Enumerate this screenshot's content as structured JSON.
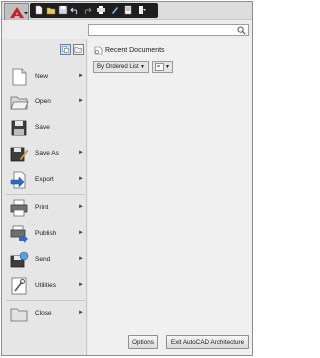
{
  "app_menu": {
    "logo_icon": "autocad-a-logo-icon",
    "quick_access_icons": [
      "new-icon",
      "open-icon",
      "save-icon",
      "undo-icon",
      "redo-icon",
      "plot-icon",
      "pen-icon",
      "layer-icon",
      "dropdown-icon"
    ]
  },
  "search": {
    "value": "",
    "icon": "magnifier-icon"
  },
  "view_toggles": [
    "large-icons-view-icon",
    "small-icons-view-icon"
  ],
  "left_menu": {
    "items": [
      {
        "label": "New",
        "icon": "new-drawing-icon",
        "has_arrow": true
      },
      {
        "label": "Open",
        "icon": "open-folder-icon",
        "has_arrow": true
      },
      {
        "label": "Save",
        "icon": "floppy-save-icon",
        "has_arrow": false
      },
      {
        "label": "Save As",
        "icon": "save-as-icon",
        "has_arrow": true
      },
      {
        "label": "Export",
        "icon": "export-icon",
        "has_arrow": true
      },
      {
        "label": "Print",
        "icon": "printer-icon",
        "has_arrow": true
      },
      {
        "label": "Publish",
        "icon": "publish-icon",
        "has_arrow": true
      },
      {
        "label": "Send",
        "icon": "send-icon",
        "has_arrow": true
      },
      {
        "label": "Utilities",
        "icon": "utilities-icon",
        "has_arrow": true
      },
      {
        "label": "Close",
        "icon": "close-folder-icon",
        "has_arrow": true
      }
    ],
    "arrow_glyph": "►"
  },
  "recent": {
    "title": "Recent Documents",
    "title_icon": "recent-documents-icon",
    "order_label": "By Ordered List",
    "dropdown_glyph": "▼",
    "view_icon": "display-mode-icon"
  },
  "footer": {
    "options_label": "Options",
    "exit_label": "Exit AutoCAD Architecture"
  },
  "colors": {
    "logo_red": "#c8202a",
    "menu_background": "#e6e6e6",
    "panel_background": "#f0f0f0",
    "qat_dark": "#1e1e1e"
  }
}
